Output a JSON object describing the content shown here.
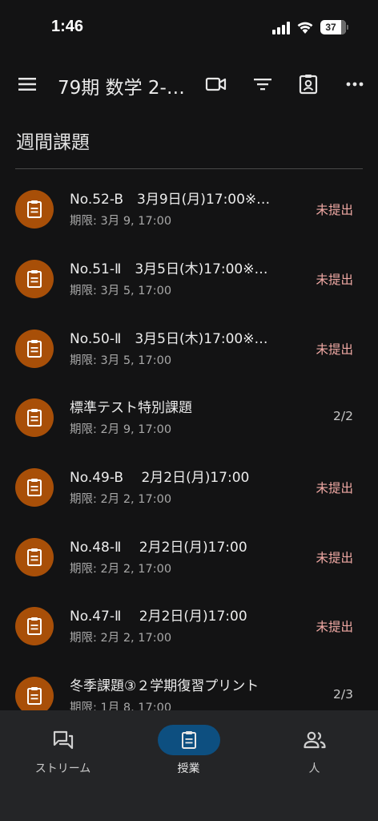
{
  "status_bar": {
    "time": "1:46",
    "battery": "37"
  },
  "app_bar": {
    "title": "79期 数学 2-…",
    "icons": [
      "menu-icon",
      "video-icon",
      "filter-icon",
      "profile-icon",
      "more-icon"
    ]
  },
  "section": {
    "title": "週間課題"
  },
  "assignments": [
    {
      "title": "No.52-B　3月9日(月)17:00※…",
      "due": "期限: 3月 9, 17:00",
      "status": "未提出",
      "status_type": "missing"
    },
    {
      "title": "No.51-Ⅱ　3月5日(木)17:00※…",
      "due": "期限: 3月 5, 17:00",
      "status": "未提出",
      "status_type": "missing"
    },
    {
      "title": "No.50-Ⅱ　3月5日(木)17:00※…",
      "due": "期限: 3月 5, 17:00",
      "status": "未提出",
      "status_type": "missing"
    },
    {
      "title": "標準テスト特別課題",
      "due": "期限: 2月 9, 17:00",
      "status": "2/2",
      "status_type": "count"
    },
    {
      "title": "No.49-B　 2月2日(月)17:00",
      "due": "期限: 2月 2, 17:00",
      "status": "未提出",
      "status_type": "missing"
    },
    {
      "title": "No.48-Ⅱ　 2月2日(月)17:00",
      "due": "期限: 2月 2, 17:00",
      "status": "未提出",
      "status_type": "missing"
    },
    {
      "title": "No.47-Ⅱ　 2月2日(月)17:00",
      "due": "期限: 2月 2, 17:00",
      "status": "未提出",
      "status_type": "missing"
    },
    {
      "title": "冬季課題③２学期復習プリント",
      "due": "期限: 1月 8, 17:00",
      "status": "2/3",
      "status_type": "count"
    }
  ],
  "bottom_nav": [
    {
      "label": "ストリーム",
      "icon": "stream-icon",
      "active": false
    },
    {
      "label": "授業",
      "icon": "classwork-icon",
      "active": true
    },
    {
      "label": "人",
      "icon": "people-icon",
      "active": false
    }
  ],
  "colors": {
    "background": "#131314",
    "assignment_icon_bg": "#a84f08",
    "missing_status": "#f0a9a4",
    "nav_active_pill": "#0d4f80",
    "nav_bar": "#242527"
  }
}
